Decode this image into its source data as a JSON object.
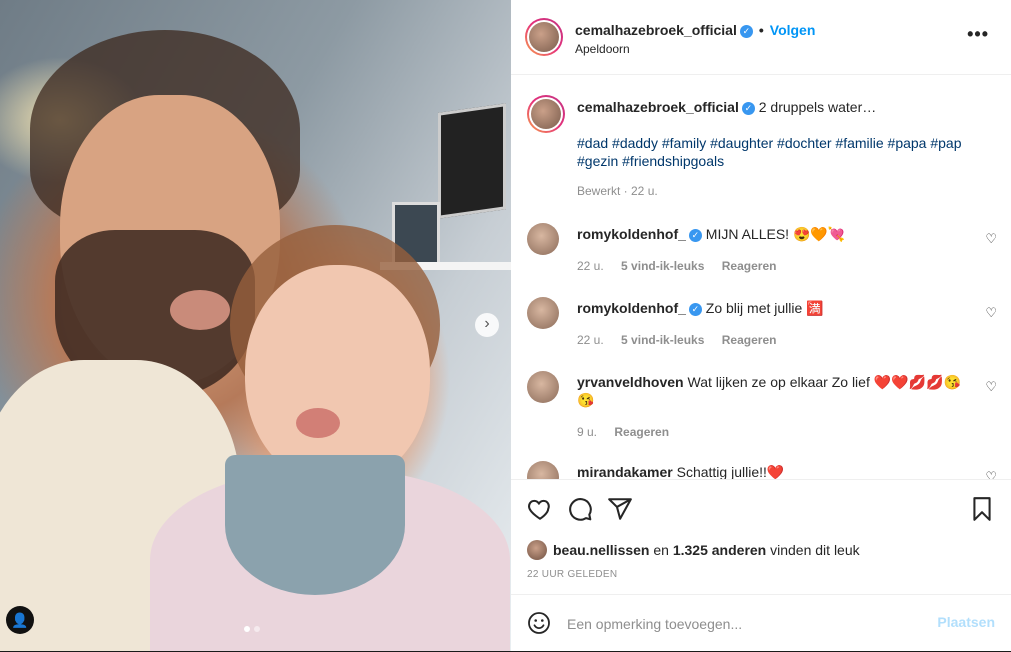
{
  "post": {
    "username": "cemalhazebroek_official",
    "location": "Apeldoorn",
    "follow_label": "Volgen",
    "more_label": "•••",
    "caption": "2 druppels water…",
    "hashtags": "#dad #daddy #family #daughter #dochter #familie #papa #pap #gezin #friendshipgoals",
    "caption_meta": "Bewerkt · 22 u."
  },
  "photo": {
    "next_glyph": "›",
    "tagged_user_glyph": "👤"
  },
  "comments": [
    {
      "username": "romykoldenhof_",
      "text": "MIJN ALLES! 😍🧡💘",
      "time": "22 u.",
      "likes": "5 vind-ik-leuks",
      "reply": "Reageren"
    },
    {
      "username": "romykoldenhof_",
      "text": "Zo blij met jullie 🈵",
      "time": "22 u.",
      "likes": "5 vind-ik-leuks",
      "reply": "Reageren"
    },
    {
      "username": "yrvanveldhoven",
      "text": "Wat lijken ze op elkaar Zo lief ❤️❤️💋💋😘😘",
      "time": "9 u.",
      "reply": "Reageren"
    },
    {
      "username": "mirandakamer",
      "text": "Schattig jullie!!❤️"
    }
  ],
  "likes": {
    "liker": "beau.nellissen",
    "connector": "en",
    "count": "1.325 anderen",
    "suffix": "vinden dit leuk"
  },
  "timestamp": "22 UUR GELEDEN",
  "add_comment": {
    "placeholder": "Een opmerking toevoegen...",
    "post_label": "Plaatsen"
  },
  "colors": {
    "link": "#0095f6",
    "hashtag": "#00376b",
    "muted": "#8e8e8e",
    "verified": "#3897f0"
  }
}
